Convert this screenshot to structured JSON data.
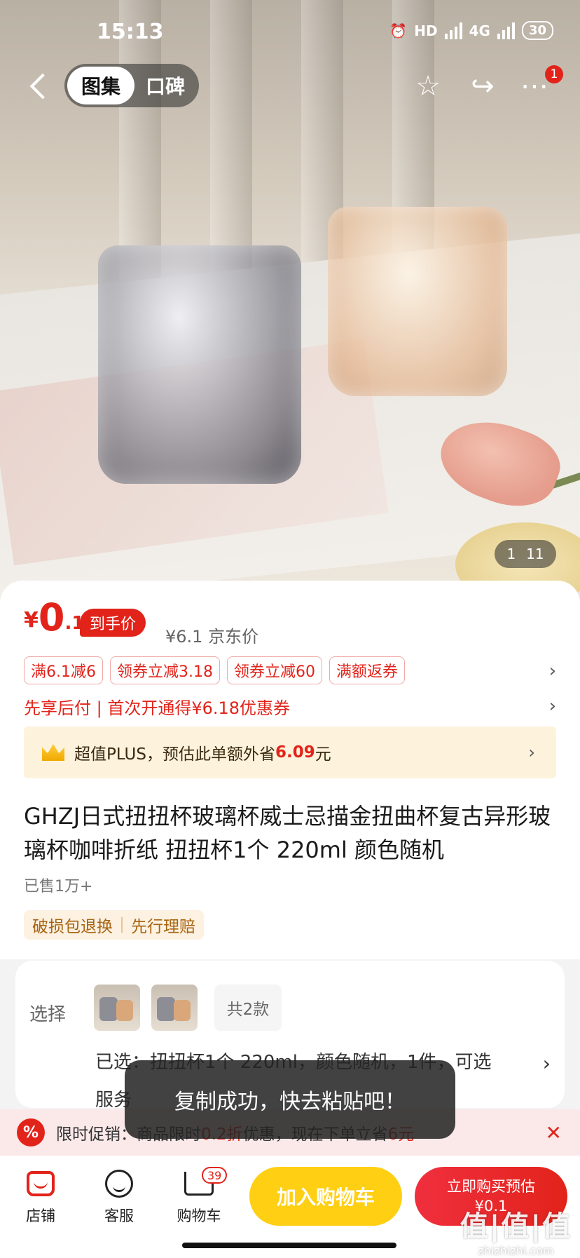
{
  "status": {
    "time": "15:13",
    "network": "4G",
    "hd": "HD",
    "battery": "30"
  },
  "nav": {
    "tab_active": "图集",
    "tab_inactive": "口碑",
    "more_badge": "1"
  },
  "gallery": {
    "current": "1",
    "total": "11"
  },
  "price": {
    "symbol": "¥",
    "integer": "0",
    "decimal": ".1",
    "hand_tag": "到手价",
    "original": "¥6.1 京东价"
  },
  "coupons": [
    "满6.1减6",
    "领券立减3.18",
    "领券立减60",
    "满额返券"
  ],
  "paylater": "先享后付 | 首次开通得¥6.18优惠券",
  "plus": {
    "prefix": "超值PLUS，预估此单额外省",
    "amount": "6.09",
    "suffix": "元"
  },
  "product": {
    "title": "GHZJ日式扭扭杯玻璃杯威士忌描金扭曲杯复古异形玻璃杯咖啡折纸 扭扭杯1个 220ml 颜色随机",
    "sold": "已售1万+",
    "guarantee": [
      "破损包退换",
      "先行理赔"
    ]
  },
  "select": {
    "label": "选择",
    "count": "共2款",
    "chosen_line1": "已选：扭扭杯1个 220ml，颜色随机，1件，可选",
    "chosen_line2": "服务"
  },
  "toast": "复制成功，快去粘贴吧！",
  "promo": {
    "icon": "%",
    "prefix": "限时促销：商品限时",
    "discount": "0.2折",
    "middle": "优惠，现在下单立省",
    "save": "6元"
  },
  "bottom": {
    "store": "店铺",
    "service": "客服",
    "cart": "购物车",
    "cart_count": "39",
    "add_cart": "加入购物车",
    "buy_line1": "立即购买预估",
    "buy_line2": "¥0.1"
  },
  "watermark": {
    "big": "值|值|值",
    "small": "zhizhizhi.com"
  },
  "colors": {
    "brand_red": "#e2231a",
    "cart_yellow": "#ffcf13",
    "plus_bg": "#fdf3dc"
  }
}
